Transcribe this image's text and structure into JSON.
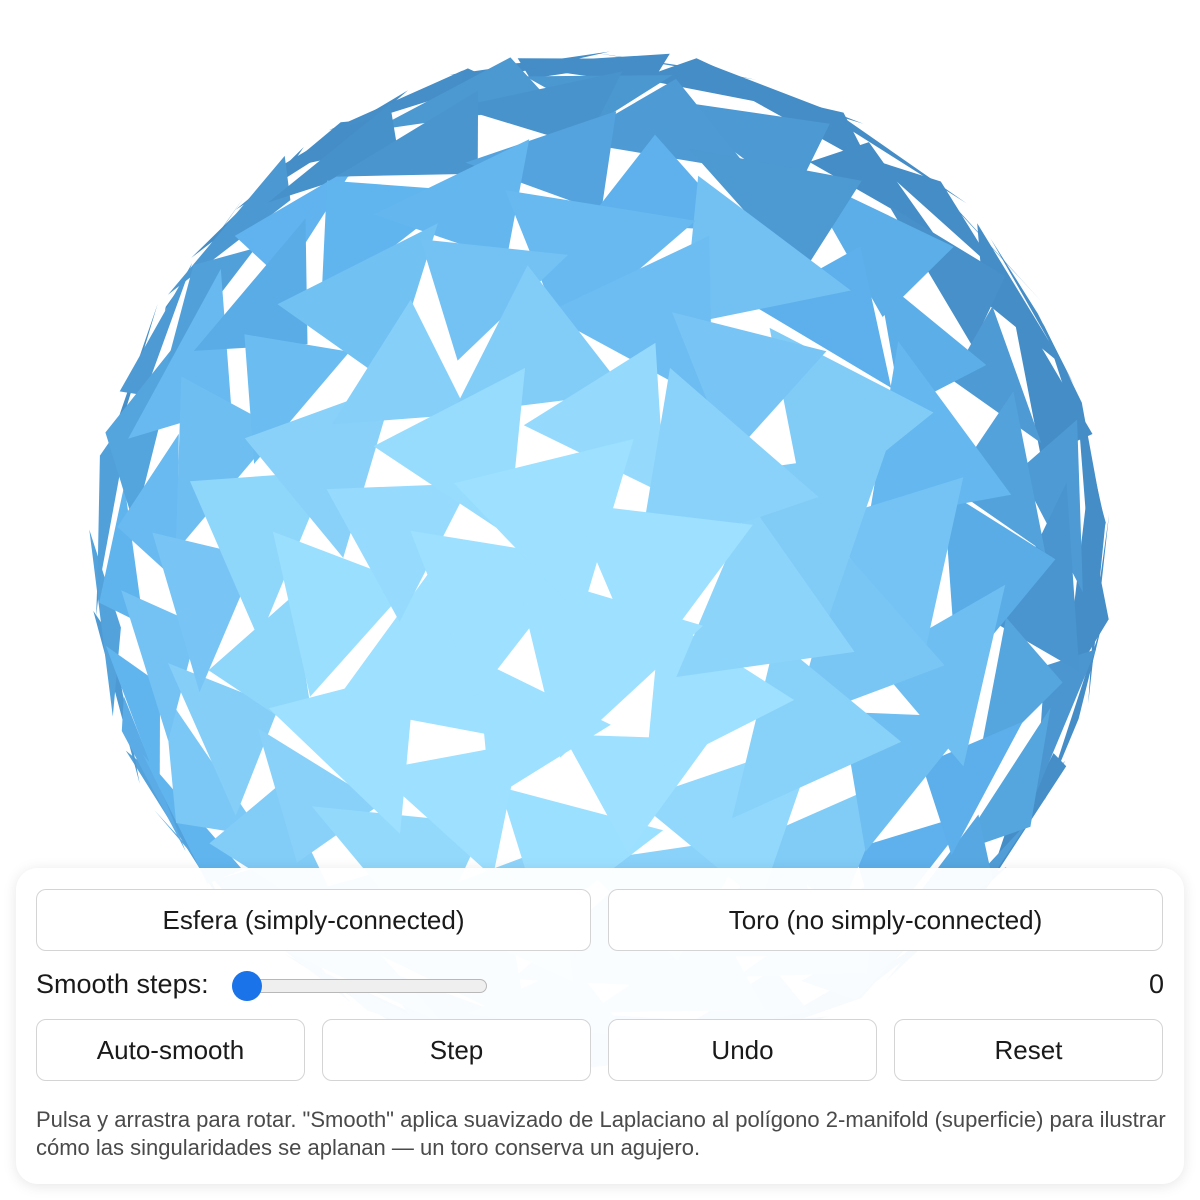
{
  "colors": {
    "mesh_base": "#5fb3ee",
    "mesh_light": "#86cdfb",
    "mesh_highlight": "#9de0ff",
    "mesh_dark": "#3f86c2",
    "mesh_shadow": "#2f6ea6",
    "accent": "#1a73e8"
  },
  "viewport": {
    "model": "sphere",
    "icon": "triangulated-sphere-mesh"
  },
  "controls": {
    "shape_buttons": {
      "sphere": "Esfera (simply-connected)",
      "torus": "Toro (no simply-connected)"
    },
    "smooth": {
      "label": "Smooth steps:",
      "value": "0",
      "level": 0
    },
    "actions": {
      "auto": "Auto-smooth",
      "step": "Step",
      "undo": "Undo",
      "reset": "Reset"
    },
    "help": "Pulsa y arrastra para rotar. \"Smooth\" aplica suavizado de Laplaciano al polígono 2-manifold (superficie) para ilustrar cómo las singularidades se aplanan — un toro conserva un agujero."
  }
}
